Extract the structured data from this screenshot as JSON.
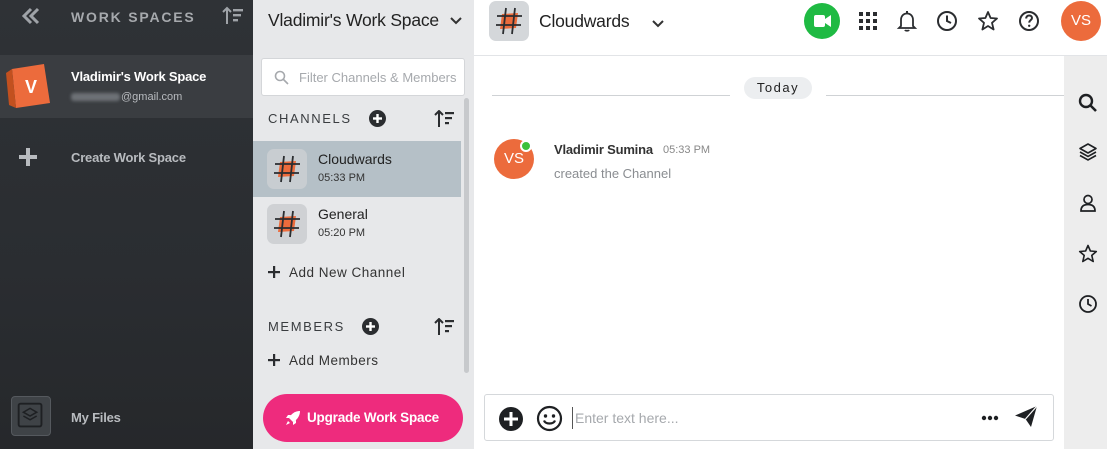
{
  "workspaces": {
    "title": "WORK SPACES",
    "active": {
      "initial": "V",
      "name": "Vladimir's Work Space",
      "email_domain": "@gmail.com",
      "color": "#ec6b3c"
    },
    "create_label": "Create Work Space",
    "files_label": "My Files",
    "icons": {
      "collapse": "double-chevron-left-icon",
      "sort": "sort-icon",
      "create": "plus-icon",
      "files": "layers-icon"
    }
  },
  "channels_panel": {
    "workspace_title": "Vladimir's Work Space",
    "filter_placeholder": "Filter Channels & Members",
    "channels_heading": "CHANNELS",
    "channels": [
      {
        "name": "Cloudwards",
        "time": "05:33 PM",
        "active": true
      },
      {
        "name": "General",
        "time": "05:20 PM",
        "active": false
      }
    ],
    "add_channel_label": "Add New Channel",
    "members_heading": "MEMBERS",
    "add_members_label": "Add Members",
    "upgrade_label": "Upgrade Work Space",
    "upgrade_color": "#ee2b7d"
  },
  "topbar": {
    "channel_name": "Cloudwards",
    "user_initials": "VS",
    "video_color": "#1fba43",
    "icons": [
      "video-call-icon",
      "apps-grid-icon",
      "bell-icon",
      "clock-icon",
      "star-icon",
      "help-icon"
    ]
  },
  "chat": {
    "day_label": "Today",
    "messages": [
      {
        "initials": "VS",
        "author": "Vladimir Sumina",
        "time": "05:33 PM",
        "text": "created the Channel",
        "online": true
      }
    ]
  },
  "composer": {
    "placeholder": "Enter text here...",
    "icons": [
      "add-icon",
      "emoji-icon",
      "more-icon",
      "send-icon"
    ]
  },
  "right_rail": {
    "icons": [
      "search-icon",
      "layers-icon",
      "user-icon",
      "star-icon",
      "clock-icon"
    ]
  },
  "colors": {
    "accent_orange": "#ec6b3c",
    "online_green": "#3cc13b",
    "sidebar_dark": "#2c2f33",
    "channel_active": "#b5c0c7"
  }
}
